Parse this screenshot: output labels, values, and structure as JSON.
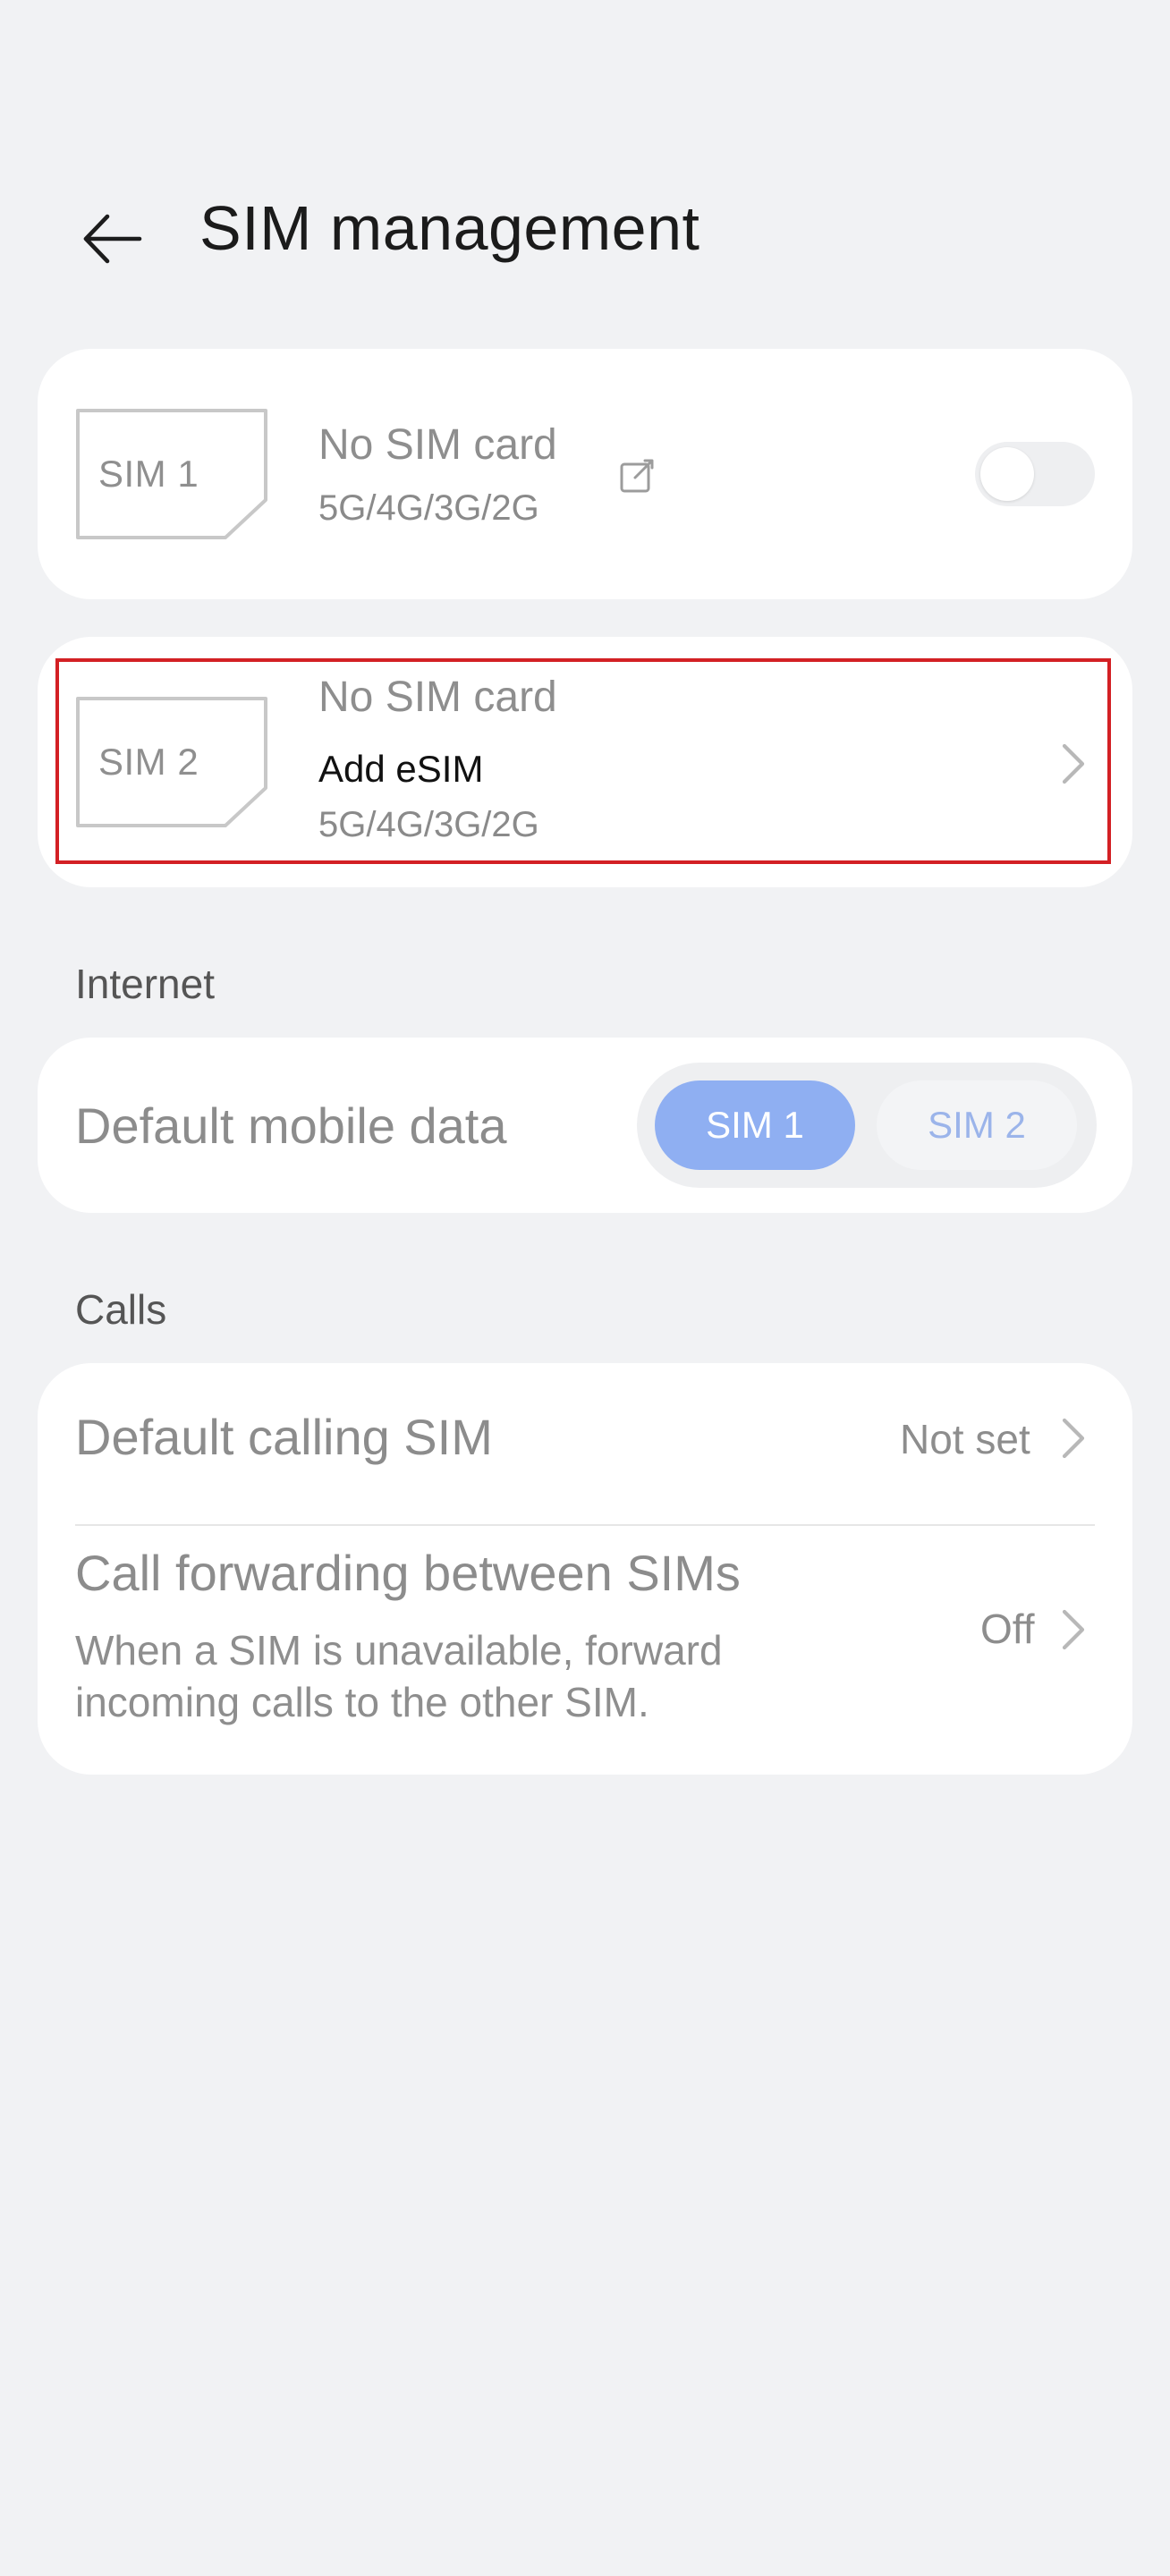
{
  "header": {
    "title": "SIM management",
    "back_icon": "arrow-left-icon"
  },
  "sim_cards": [
    {
      "slot_label": "SIM 1",
      "status": "No SIM card",
      "bands": "5G/4G/3G/2G",
      "edit_icon": "edit-icon",
      "toggle_enabled": false
    },
    {
      "slot_label": "SIM 2",
      "status": "No SIM card",
      "action": "Add eSIM",
      "bands": "5G/4G/3G/2G",
      "chevron_icon": "chevron-right-icon",
      "highlighted": true
    }
  ],
  "internet": {
    "section_title": "Internet",
    "default_mobile_data": {
      "label": "Default mobile data",
      "options": [
        "SIM 1",
        "SIM 2"
      ],
      "selected": "SIM 1"
    }
  },
  "calls": {
    "section_title": "Calls",
    "default_calling_sim": {
      "label": "Default calling SIM",
      "value": "Not set"
    },
    "call_forwarding": {
      "label": "Call forwarding between SIMs",
      "description": "When a SIM is unavailable, forward incoming calls to the other SIM.",
      "value": "Off"
    }
  },
  "colors": {
    "background": "#f1f2f4",
    "card": "#ffffff",
    "accent": "#8faff2",
    "highlight": "#d32024"
  }
}
